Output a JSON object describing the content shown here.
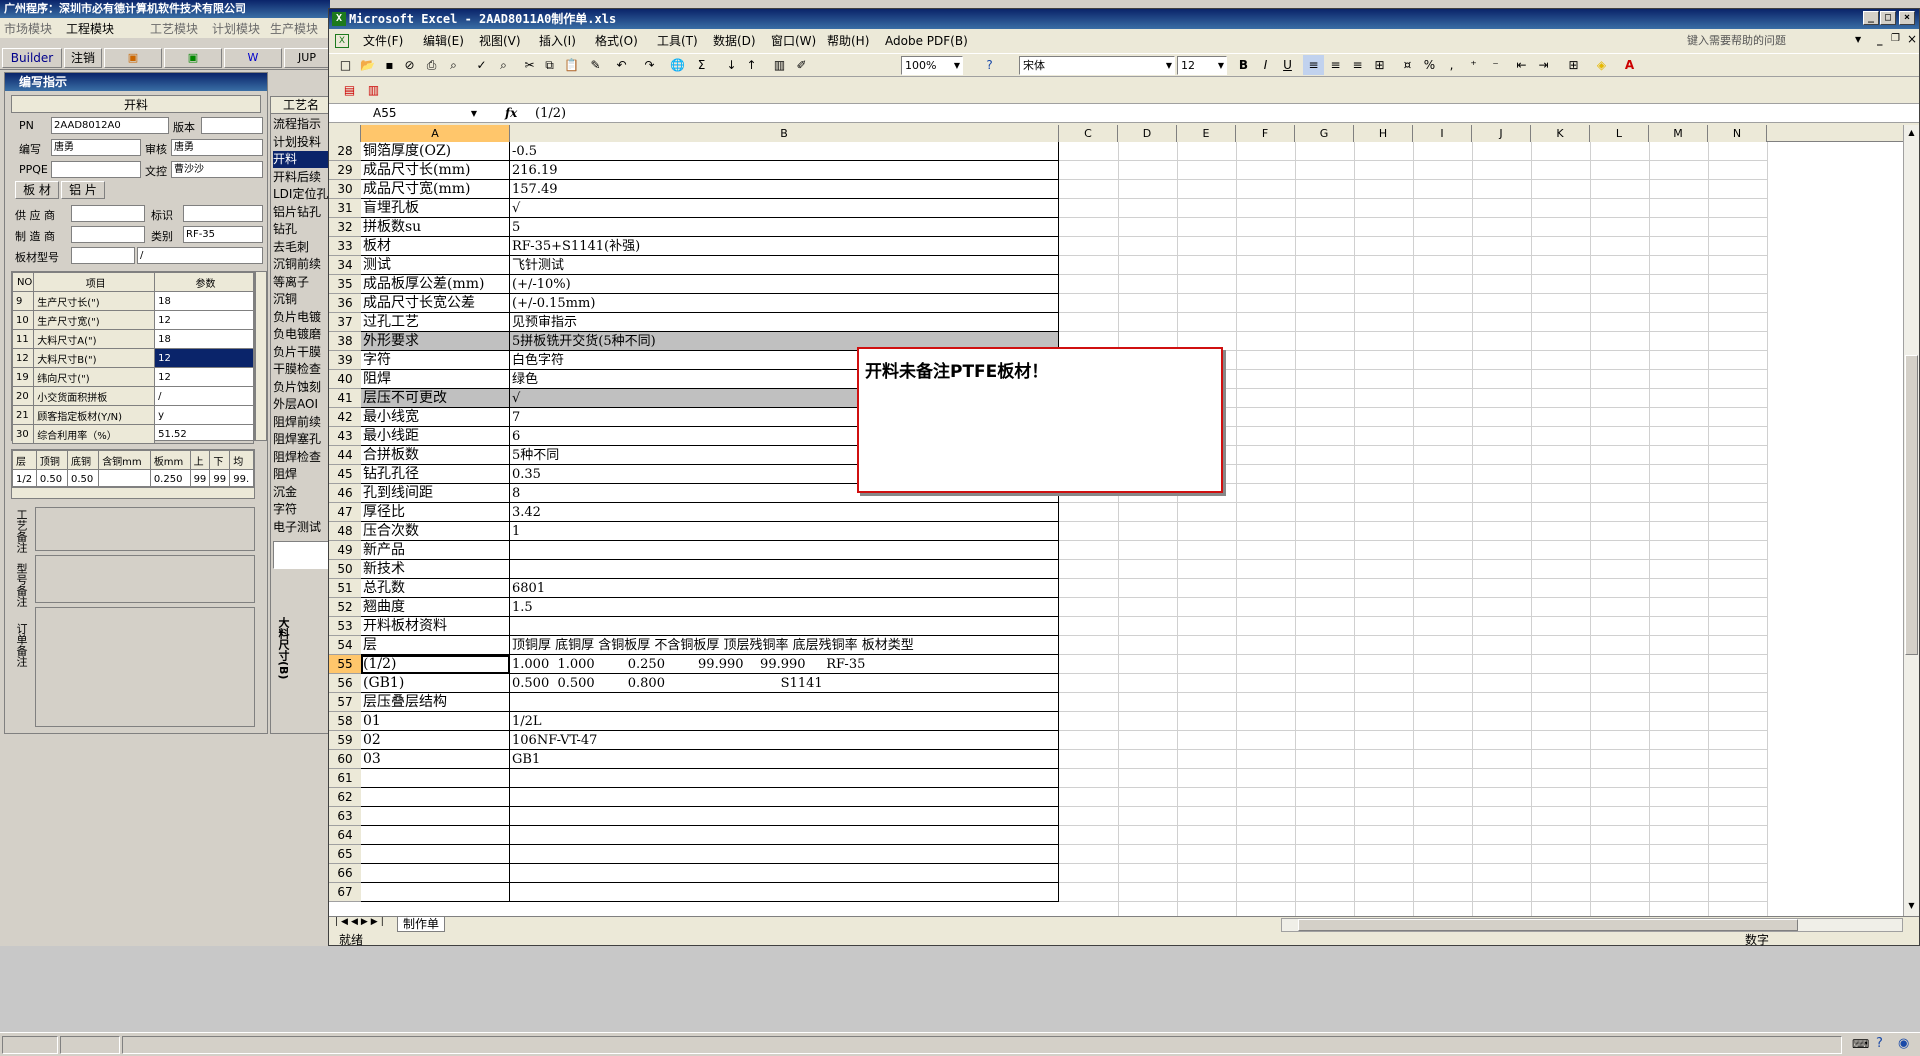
{
  "app": {
    "title": "广州程序：深圳市必有德计算机软件技术有限公司",
    "modules": [
      "市场模块",
      "工程模块",
      "工艺模块",
      "计划模块",
      "生产模块"
    ],
    "toolbar": [
      "Builder",
      "注销",
      "JUP"
    ]
  },
  "left_panel": {
    "title": "编写指示",
    "section": "开料",
    "pn_label": "PN",
    "pn": "2AAD8012A0",
    "version_label": "版本",
    "editor_label": "编写",
    "editor": "唐勇",
    "review_label": "审核",
    "reviewer": "唐勇",
    "ppqe_label": "PPQE",
    "control_label": "文控",
    "controller": "曹沙沙",
    "tabs": [
      "板 材",
      "铝 片"
    ],
    "supplier_label": "供 应 商",
    "mark_label": "标识",
    "maker_label": "制 造 商",
    "type_label": "类别",
    "type": "RF-35",
    "model_label": "板材型号",
    "model": "/",
    "table_headers": [
      "NO",
      "项目",
      "参数"
    ],
    "rows": [
      {
        "no": "9",
        "item": "生产尺寸长(\")",
        "val": "18"
      },
      {
        "no": "10",
        "item": "生产尺寸宽(\")",
        "val": "12"
      },
      {
        "no": "11",
        "item": "大料尺寸A(\")",
        "val": "18"
      },
      {
        "no": "12",
        "item": "大料尺寸B(\")",
        "val": "12"
      },
      {
        "no": "19",
        "item": "纬向尺寸(\")",
        "val": "12"
      },
      {
        "no": "20",
        "item": "小交货面积拼板",
        "val": "/"
      },
      {
        "no": "21",
        "item": "顾客指定板材(Y/N)",
        "val": "y"
      },
      {
        "no": "30",
        "item": "综合利用率（%）",
        "val": "51.52"
      }
    ],
    "layer_headers": [
      "层",
      "顶铜",
      "底铜",
      "含铜mm",
      "板mm",
      "上",
      "下",
      "均"
    ],
    "layer_row": [
      "1/2",
      "0.50",
      "0.50",
      "",
      "0.250",
      "99",
      "99",
      "99."
    ],
    "side_labels": [
      "工艺备注",
      "型号备注",
      "订单备注"
    ]
  },
  "mid_panel": {
    "title": "工艺名",
    "items": [
      "流程指示",
      "计划投料",
      "开料",
      "开料后续",
      "LDI定位孔",
      "铝片钻孔",
      "钻孔",
      "去毛刺",
      "沉铜前续",
      "等离子",
      "沉铜",
      "负片电镀",
      "负电镀磨",
      "负片干膜",
      "干膜检查",
      "负片蚀刻",
      "外层AOI",
      "阻焊前续",
      "阻焊塞孔",
      "阻焊检查",
      "阻焊",
      "沉金",
      "字符",
      "电子测试"
    ],
    "vlabel": "大料尺寸(B)"
  },
  "excel": {
    "title": "Microsoft Excel - 2AAD8011A0制作单.xls",
    "menus": [
      "文件(F)",
      "编辑(E)",
      "视图(V)",
      "插入(I)",
      "格式(O)",
      "工具(T)",
      "数据(D)",
      "窗口(W)",
      "帮助(H)",
      "Adobe PDF(B)"
    ],
    "help_placeholder": "键入需要帮助的问题",
    "zoom": "100%",
    "font": "宋体",
    "size": "12",
    "namebox": "A55",
    "formula": "(1/2)",
    "col_headers": [
      "A",
      "B",
      "C",
      "D",
      "E",
      "F",
      "G",
      "H",
      "I",
      "J",
      "K",
      "L",
      "M",
      "N"
    ],
    "sheet_tab": "制作单",
    "status": "就绪",
    "status_right": "数字",
    "comment": "开料未备注PTFE板材！",
    "rows": [
      {
        "r": "28",
        "a": "铜箔厚度(OZ)",
        "b": "-0.5"
      },
      {
        "r": "29",
        "a": "成品尺寸长(mm)",
        "b": "216.19"
      },
      {
        "r": "30",
        "a": "成品尺寸宽(mm)",
        "b": "157.49"
      },
      {
        "r": "31",
        "a": "盲埋孔板",
        "b": "√"
      },
      {
        "r": "32",
        "a": "拼板数su",
        "b": "5"
      },
      {
        "r": "33",
        "a": "板材",
        "b": "RF-35+S1141(补强)"
      },
      {
        "r": "34",
        "a": "测试",
        "b": "飞针测试"
      },
      {
        "r": "35",
        "a": "成品板厚公差(mm)",
        "b": "(+/-10%)"
      },
      {
        "r": "36",
        "a": "成品尺寸长宽公差",
        "b": "(+/-0.15mm)"
      },
      {
        "r": "37",
        "a": "过孔工艺",
        "b": "见预审指示"
      },
      {
        "r": "38",
        "a": "外形要求",
        "b": "5拼板铣开交货(5种不同)"
      },
      {
        "r": "39",
        "a": "字符",
        "b": "白色字符"
      },
      {
        "r": "40",
        "a": "阻焊",
        "b": "绿色"
      },
      {
        "r": "41",
        "a": "层压不可更改",
        "b": "√"
      },
      {
        "r": "42",
        "a": "最小线宽",
        "b": "7"
      },
      {
        "r": "43",
        "a": "最小线距",
        "b": "6"
      },
      {
        "r": "44",
        "a": "合拼板数",
        "b": "5种不同"
      },
      {
        "r": "45",
        "a": "钻孔孔径",
        "b": "0.35"
      },
      {
        "r": "46",
        "a": "孔到线间距",
        "b": "8"
      },
      {
        "r": "47",
        "a": "厚径比",
        "b": "3.42"
      },
      {
        "r": "48",
        "a": "压合次数",
        "b": "1"
      },
      {
        "r": "49",
        "a": "新产品",
        "b": ""
      },
      {
        "r": "50",
        "a": "新技术",
        "b": ""
      },
      {
        "r": "51",
        "a": "总孔数",
        "b": "6801"
      },
      {
        "r": "52",
        "a": "翘曲度",
        "b": "1.5"
      },
      {
        "r": "53",
        "a": "开料板材资料",
        "b": ""
      },
      {
        "r": "54",
        "a": "层",
        "b": "顶铜厚 底铜厚 含铜板厚 不含铜板厚 顶层残铜率 底层残铜率 板材类型"
      },
      {
        "r": "55",
        "a": "(1/2)",
        "b": "1.000  1.000        0.250        99.990    99.990     RF-35"
      },
      {
        "r": "56",
        "a": "(GB1)",
        "b": "0.500  0.500        0.800                            S1141"
      },
      {
        "r": "57",
        "a": "层压叠层结构",
        "b": ""
      },
      {
        "r": "58",
        "a": "01",
        "b": "1/2L"
      },
      {
        "r": "59",
        "a": "02",
        "b": "106NF-VT-47"
      },
      {
        "r": "60",
        "a": "03",
        "b": "GB1"
      },
      {
        "r": "61",
        "a": "",
        "b": ""
      },
      {
        "r": "62",
        "a": "",
        "b": ""
      },
      {
        "r": "63",
        "a": "",
        "b": ""
      },
      {
        "r": "64",
        "a": "",
        "b": ""
      },
      {
        "r": "65",
        "a": "",
        "b": ""
      },
      {
        "r": "66",
        "a": "",
        "b": ""
      },
      {
        "r": "67",
        "a": "",
        "b": ""
      }
    ]
  }
}
